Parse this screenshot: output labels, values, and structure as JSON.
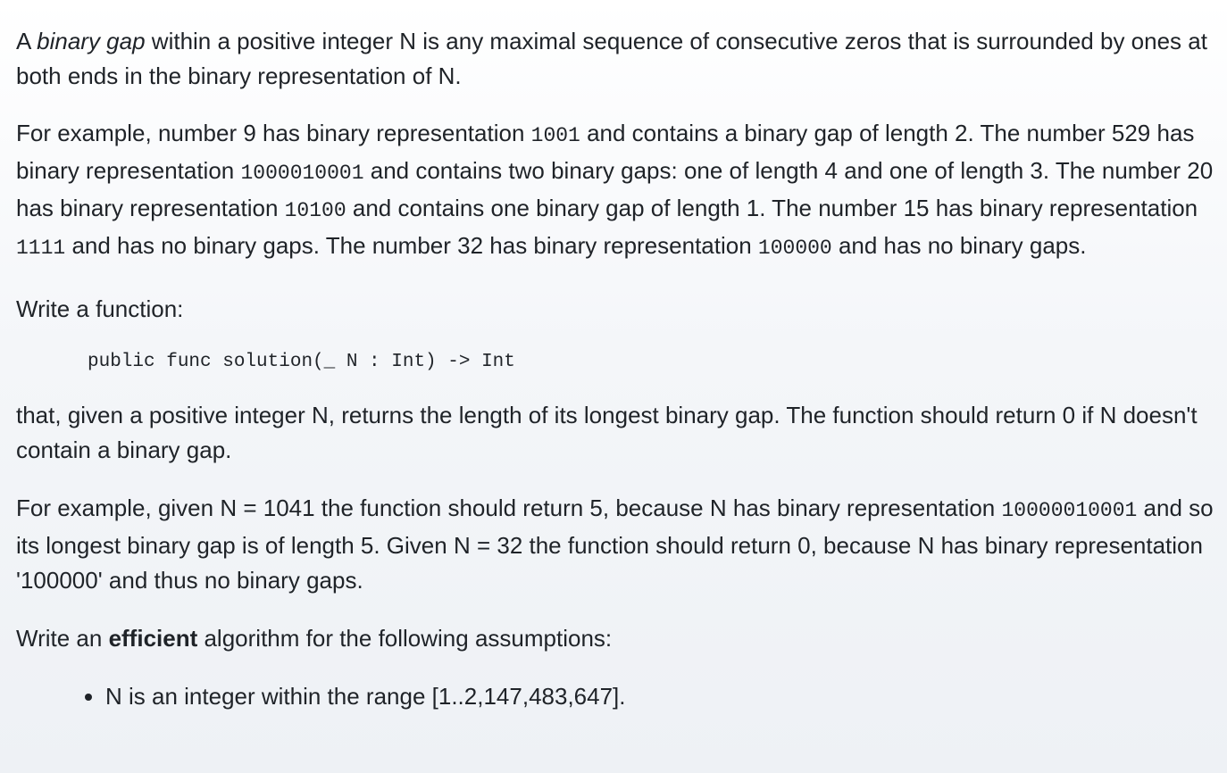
{
  "intro": {
    "t1": "A ",
    "term": "binary gap",
    "t2": " within a positive integer N is any maximal sequence of consecutive zeros that is surrounded by ones at both ends in the binary representation of N."
  },
  "examples": {
    "t1": "For example, number 9 has binary representation ",
    "c1": "1001",
    "t2": " and contains a binary gap of length 2. The number 529 has binary representation ",
    "c2": "1000010001",
    "t3": " and contains two binary gaps: one of length 4 and one of length 3. The number 20 has binary representation ",
    "c3": "10100",
    "t4": " and contains one binary gap of length 1. The number 15 has binary representation ",
    "c4": "1111",
    "t5": " and has no binary gaps. The number 32 has binary representation ",
    "c5": "100000",
    "t6": " and has no binary gaps."
  },
  "write_function": "Write a function:",
  "signature": "public func solution(_ N : Int) -> Int",
  "returns": "that, given a positive integer N, returns the length of its longest binary gap. The function should return 0 if N doesn't contain a binary gap.",
  "example2": {
    "t1": "For example, given N = 1041 the function should return 5, because N has binary representation ",
    "c1": "10000010001",
    "t2": " and so its longest binary gap is of length 5. Given N = 32 the function should return 0, because N has binary representation '100000' and thus no binary gaps."
  },
  "efficient": {
    "t1": "Write an ",
    "bold": "efficient",
    "t2": " algorithm for the following assumptions:"
  },
  "assumptions": [
    "N is an integer within the range [1..2,147,483,647]."
  ]
}
